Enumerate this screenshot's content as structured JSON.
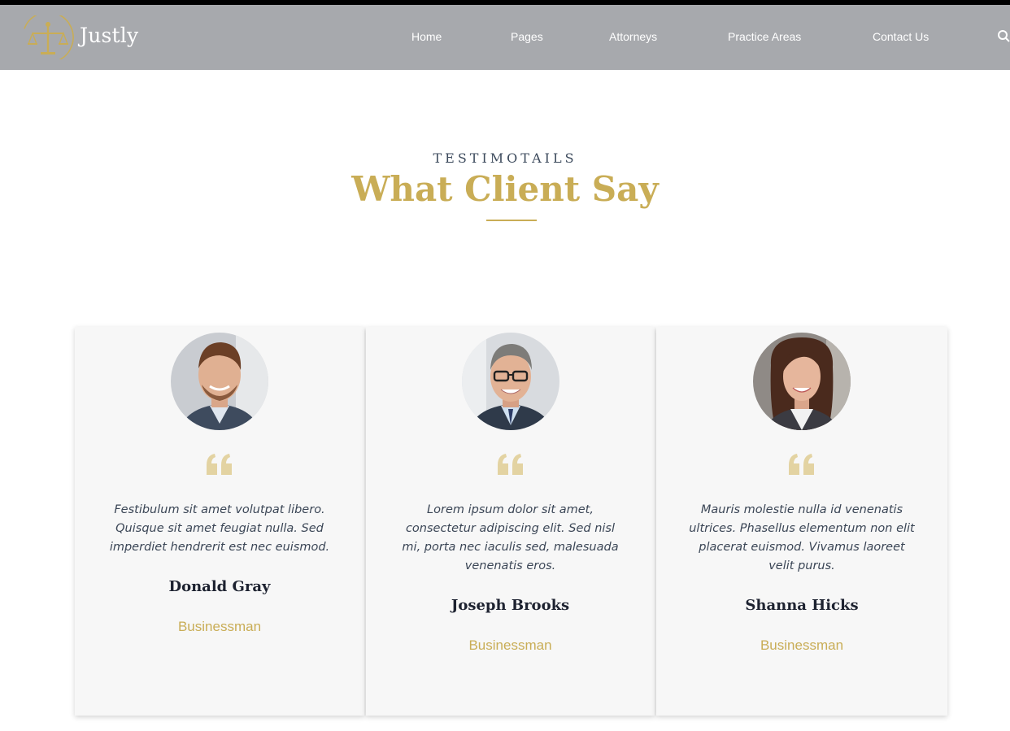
{
  "brand": {
    "name": "Justly",
    "accent": "#c9ad56"
  },
  "nav": {
    "items": [
      {
        "label": "Home"
      },
      {
        "label": "Pages"
      },
      {
        "label": "Attorneys"
      },
      {
        "label": "Practice Areas"
      },
      {
        "label": "Contact Us"
      }
    ],
    "search_icon": "search-icon"
  },
  "section": {
    "kicker": "TESTIMOTAILS",
    "title": "What Client Say"
  },
  "testimonials": [
    {
      "quote": "Festibulum sit amet volutpat libero. Quisque sit amet feugiat nulla. Sed imperdiet hendrerit est nec euismod.",
      "name": "Donald Gray",
      "role": "Businessman"
    },
    {
      "quote": "Lorem ipsum dolor sit amet, consectetur adipiscing elit. Sed nisl mi, porta nec iaculis sed, malesuada venenatis eros.",
      "name": "Joseph Brooks",
      "role": "Businessman"
    },
    {
      "quote": "Mauris molestie nulla id venenatis ultrices. Phasellus elementum non elit placerat euismod. Vivamus laoreet velit purus.",
      "name": "Shanna Hicks",
      "role": "Businessman"
    }
  ]
}
